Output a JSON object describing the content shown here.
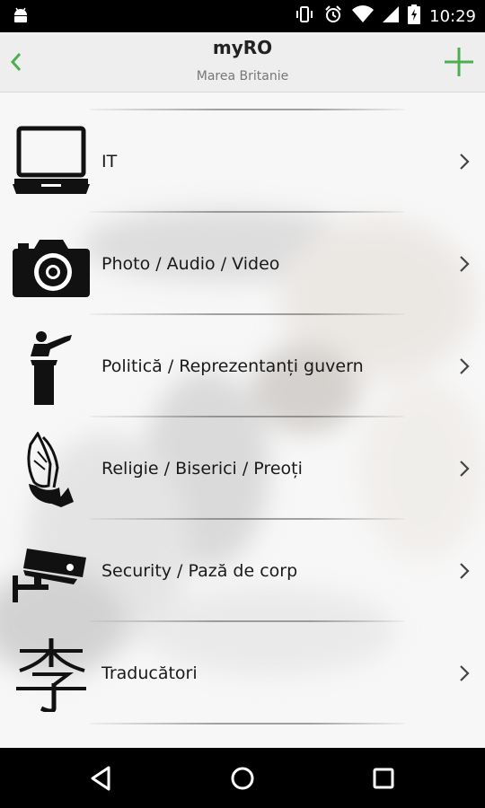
{
  "status_bar": {
    "time": "10:29",
    "icons": [
      "android-icon",
      "vibrate-icon",
      "alarm-icon",
      "wifi-icon",
      "signal-icon",
      "battery-icon"
    ]
  },
  "app_bar": {
    "title": "myRO",
    "subtitle": "Marea Britanie",
    "back_icon": "chevron-left-icon",
    "add_icon": "plus-icon",
    "accent_color": "#4caf50"
  },
  "categories": [
    {
      "label": "IT",
      "icon": "laptop-icon"
    },
    {
      "label": "Photo / Audio / Video",
      "icon": "camera-icon"
    },
    {
      "label": "Politică / Reprezentanți guvern",
      "icon": "speaker-podium-icon"
    },
    {
      "label": "Religie / Biserici / Preoți",
      "icon": "praying-hands-icon"
    },
    {
      "label": "Security / Pază de corp",
      "icon": "security-camera-icon"
    },
    {
      "label": "Traducători",
      "icon": "chinese-character-icon"
    }
  ],
  "nav_bar": {
    "buttons": [
      "back-triangle-icon",
      "home-circle-icon",
      "recents-square-icon"
    ]
  }
}
